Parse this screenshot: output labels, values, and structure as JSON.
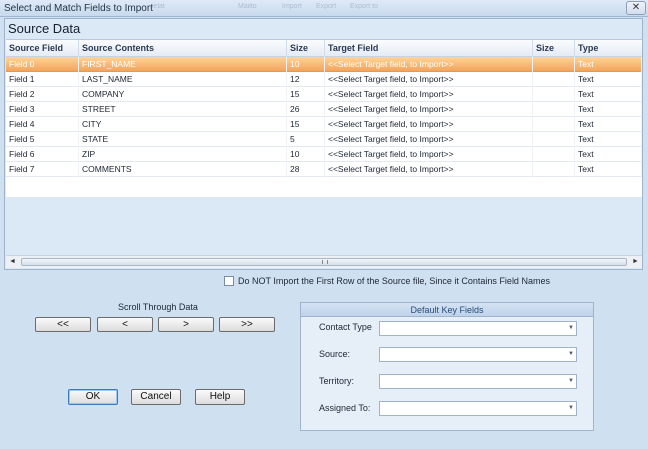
{
  "window": {
    "title": "Select and Match Fields to Import",
    "close_glyph": "✕",
    "background_toolbar_ghost": [
      "ielat",
      "Mailto",
      "Import",
      "Export",
      "Export to"
    ]
  },
  "source_panel": {
    "title": "Source Data"
  },
  "grid": {
    "columns": [
      "Source Field",
      "Source Contents",
      "Size",
      "Target Field",
      "Size",
      "Type"
    ],
    "rows": [
      {
        "source_field": "Field 0",
        "contents": "FIRST_NAME",
        "size": "10",
        "target": "<<Select Target field, to Import>>",
        "target_size": "",
        "type": "Text",
        "selected": true
      },
      {
        "source_field": "Field 1",
        "contents": "LAST_NAME",
        "size": "12",
        "target": "<<Select Target field, to Import>>",
        "target_size": "",
        "type": "Text",
        "selected": false
      },
      {
        "source_field": "Field 2",
        "contents": "COMPANY",
        "size": "15",
        "target": "<<Select Target field, to Import>>",
        "target_size": "",
        "type": "Text",
        "selected": false
      },
      {
        "source_field": "Field 3",
        "contents": "STREET",
        "size": "26",
        "target": "<<Select Target field, to Import>>",
        "target_size": "",
        "type": "Text",
        "selected": false
      },
      {
        "source_field": "Field 4",
        "contents": "CITY",
        "size": "15",
        "target": "<<Select Target field, to Import>>",
        "target_size": "",
        "type": "Text",
        "selected": false
      },
      {
        "source_field": "Field 5",
        "contents": "STATE",
        "size": "5",
        "target": "<<Select Target field, to Import>>",
        "target_size": "",
        "type": "Text",
        "selected": false
      },
      {
        "source_field": "Field 6",
        "contents": "ZIP",
        "size": "10",
        "target": "<<Select Target field, to Import>>",
        "target_size": "",
        "type": "Text",
        "selected": false
      },
      {
        "source_field": "Field 7",
        "contents": "COMMENTS",
        "size": "28",
        "target": "<<Select Target field, to Import>>",
        "target_size": "",
        "type": "Text",
        "selected": false
      }
    ]
  },
  "scrollbar": {
    "left_arrow": "◄",
    "right_arrow": "►"
  },
  "options": {
    "skip_first_row_label": "Do NOT Import the First Row of the Source file, Since it Contains Field Names",
    "skip_first_row_checked": false
  },
  "navigation": {
    "title": "Scroll Through Data",
    "first": "<<",
    "prev": "<",
    "next": ">",
    "last": ">>"
  },
  "actions": {
    "ok": "OK",
    "cancel": "Cancel",
    "help": "Help"
  },
  "default_key_fields": {
    "title": "Default Key Fields",
    "fields": [
      {
        "label": "Contact Type",
        "value": ""
      },
      {
        "label": "Source:",
        "value": ""
      },
      {
        "label": "Territory:",
        "value": ""
      },
      {
        "label": "Assigned To:",
        "value": ""
      }
    ],
    "caret": "▼"
  },
  "colors": {
    "selected_row": "#f2a45c",
    "panel_background": "#dbe8f6",
    "window_background": "#cfe0f1"
  }
}
